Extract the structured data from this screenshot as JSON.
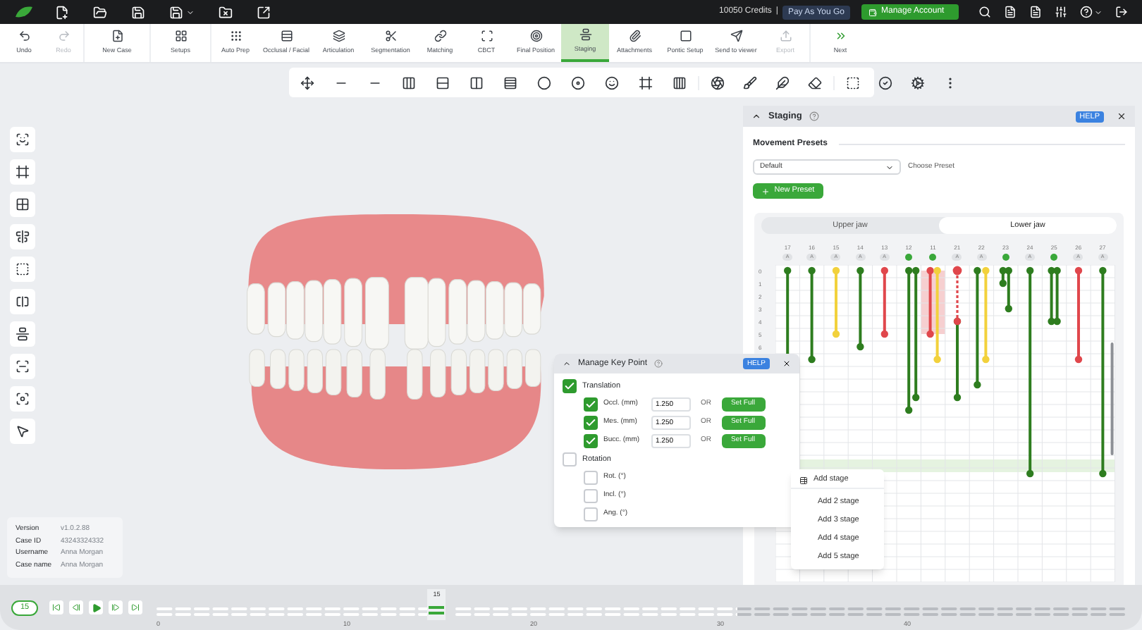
{
  "top_bar": {
    "credits": "10050 Credits",
    "separator": "|",
    "plan_button": "Pay As You Go",
    "account_button": "Manage Account"
  },
  "toolbar": {
    "groups": [
      [
        {
          "label": "Undo",
          "selected": false,
          "disabled": false
        },
        {
          "label": "Redo",
          "selected": false,
          "disabled": true
        }
      ],
      [
        {
          "label": "New Case",
          "selected": false,
          "disabled": false
        }
      ],
      [
        {
          "label": "Setups",
          "selected": false,
          "disabled": false
        }
      ],
      [
        {
          "label": "Auto Prep",
          "selected": false,
          "disabled": false
        },
        {
          "label": "Occlusal / Facial",
          "selected": false,
          "disabled": false
        },
        {
          "label": "Articulation",
          "selected": false,
          "disabled": false
        },
        {
          "label": "Segmentation",
          "selected": false,
          "disabled": false
        },
        {
          "label": "Matching",
          "selected": false,
          "disabled": false
        },
        {
          "label": "CBCT",
          "selected": false,
          "disabled": false
        },
        {
          "label": "Final Position",
          "selected": false,
          "disabled": false
        },
        {
          "label": "Staging",
          "selected": true,
          "disabled": false
        },
        {
          "label": "Attachments",
          "selected": false,
          "disabled": false
        },
        {
          "label": "Pontic Setup",
          "selected": false,
          "disabled": false
        },
        {
          "label": "Send to viewer",
          "selected": false,
          "disabled": false
        },
        {
          "label": "Export",
          "selected": false,
          "disabled": true
        }
      ],
      [
        {
          "label": "Next",
          "selected": false,
          "disabled": false
        }
      ]
    ]
  },
  "case_info": [
    {
      "label": "Version",
      "value": "v1.0.2.88"
    },
    {
      "label": "Case ID",
      "value": "43243324332"
    },
    {
      "label": "Username",
      "value": "Anna Morgan"
    },
    {
      "label": "Case name",
      "value": "Anna Morgan"
    }
  ],
  "staging_panel": {
    "title": "Staging",
    "help": "HELP",
    "section": "Movement Presets",
    "preset": {
      "value": "Default"
    },
    "preset_hint": "Choose Preset",
    "new_preset": "New Preset",
    "jaw_tabs": [
      {
        "label": "Upper jaw",
        "selected": false
      },
      {
        "label": "Lower jaw",
        "selected": true
      }
    ],
    "teeth": [
      {
        "number": "17",
        "confirmed": false,
        "badge": "A"
      },
      {
        "number": "16",
        "confirmed": false,
        "badge": "A"
      },
      {
        "number": "15",
        "confirmed": false,
        "badge": "A"
      },
      {
        "number": "14",
        "confirmed": false,
        "badge": "A"
      },
      {
        "number": "13",
        "confirmed": false,
        "badge": "A"
      },
      {
        "number": "12",
        "confirmed": true
      },
      {
        "number": "11",
        "confirmed": true
      },
      {
        "number": "21",
        "confirmed": false,
        "badge": "A"
      },
      {
        "number": "22",
        "confirmed": false,
        "badge": "A"
      },
      {
        "number": "23",
        "confirmed": true
      },
      {
        "number": "24",
        "confirmed": false,
        "badge": "A"
      },
      {
        "number": "25",
        "confirmed": true
      },
      {
        "number": "26",
        "confirmed": false,
        "badge": "A"
      },
      {
        "number": "27",
        "confirmed": false,
        "badge": "A"
      }
    ],
    "row_labels": [
      "0",
      "1",
      "2",
      "3",
      "4",
      "5",
      "6"
    ]
  },
  "key_point_dialog": {
    "title": "Manage Key Point",
    "help": "HELP",
    "groups": [
      {
        "label": "Translation",
        "checked": true,
        "items": [
          {
            "label": "Occl. (mm)",
            "checked": true,
            "value": "1.250",
            "or": "OR",
            "button": "Set Full"
          },
          {
            "label": "Mes. (mm)",
            "checked": true,
            "value": "1.250",
            "or": "OR",
            "button": "Set Full"
          },
          {
            "label": "Bucc. (mm)",
            "checked": true,
            "value": "1.250",
            "or": "OR",
            "button": "Set Full"
          }
        ]
      },
      {
        "label": "Rotation",
        "checked": false,
        "items": [
          {
            "label": "Rot. (°)",
            "checked": false
          },
          {
            "label": "Incl. (°)",
            "checked": false
          },
          {
            "label": "Ang. (°)",
            "checked": false
          }
        ]
      }
    ]
  },
  "context_menu": {
    "items": [
      {
        "label": "Add stage",
        "kind": "primary"
      },
      {
        "label": "Add 2 stage",
        "kind": "plain"
      },
      {
        "label": "Add 3 stage",
        "kind": "plain"
      },
      {
        "label": "Add 4 stage",
        "kind": "plain"
      },
      {
        "label": "Add 5 stage",
        "kind": "plain"
      }
    ]
  },
  "timeline": {
    "current": "15",
    "playhead": {
      "label": "15",
      "level": 0.29
    },
    "loaded": {
      "level": 0.6
    },
    "ticks": [
      "0",
      "10",
      "20",
      "30",
      "40"
    ]
  }
}
